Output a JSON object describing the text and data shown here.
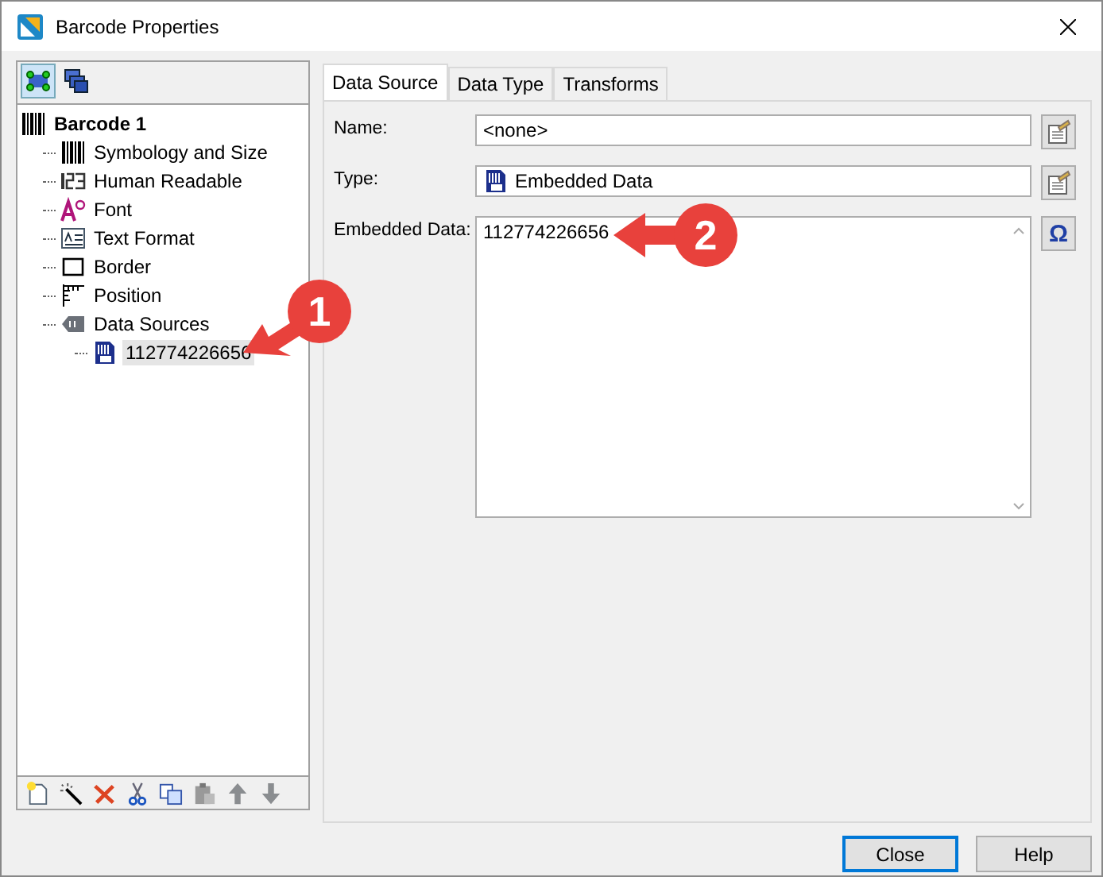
{
  "window": {
    "title": "Barcode Properties"
  },
  "view_buttons": [
    {
      "selected": true
    },
    {
      "selected": false
    }
  ],
  "tree": {
    "label": "Barcode 1",
    "kind": "barcode",
    "selected": false,
    "children": [
      {
        "label": "Symbology and Size",
        "kind": "symbology",
        "selected": false
      },
      {
        "label": "Human Readable",
        "kind": "human",
        "selected": false
      },
      {
        "label": "Font",
        "kind": "font",
        "selected": false
      },
      {
        "label": "Text Format",
        "kind": "textformat",
        "selected": false
      },
      {
        "label": "Border",
        "kind": "border",
        "selected": false
      },
      {
        "label": "Position",
        "kind": "position",
        "selected": false
      },
      {
        "label": "Data Sources",
        "kind": "datasources",
        "selected": false,
        "children": [
          {
            "label": "112774226656",
            "kind": "embedded",
            "selected": true
          }
        ]
      }
    ]
  },
  "tabs": [
    {
      "label": "Data Source",
      "selected": true
    },
    {
      "label": "Data Type",
      "selected": false
    },
    {
      "label": "Transforms",
      "selected": false
    }
  ],
  "fields": [
    {
      "label": "Name:",
      "value": "<none>",
      "kind": "text"
    },
    {
      "label": "Type:",
      "value": "Embedded Data",
      "kind": "type"
    },
    {
      "label": "Embedded Data:",
      "value": "112774226656",
      "kind": "multiline",
      "button_symbol": "Ω"
    }
  ],
  "buttons": [
    {
      "label": "Close",
      "default": true
    },
    {
      "label": "Help",
      "default": false
    }
  ],
  "callouts": [
    {
      "number": "1"
    },
    {
      "number": "2"
    }
  ]
}
